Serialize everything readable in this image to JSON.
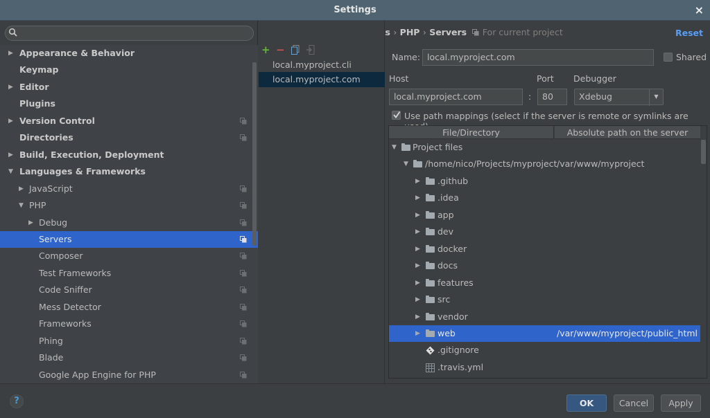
{
  "window": {
    "title": "Settings",
    "close_icon": "×"
  },
  "search": {
    "placeholder": "",
    "value": ""
  },
  "sidebar": {
    "items": [
      {
        "label": "Appearance & Behavior",
        "level": 0,
        "expander": "collapsed",
        "bold": true,
        "project_icon": false,
        "selected": false
      },
      {
        "label": "Keymap",
        "level": 0,
        "expander": "none",
        "bold": true,
        "project_icon": false,
        "selected": false
      },
      {
        "label": "Editor",
        "level": 0,
        "expander": "collapsed",
        "bold": true,
        "project_icon": false,
        "selected": false
      },
      {
        "label": "Plugins",
        "level": 0,
        "expander": "none",
        "bold": true,
        "project_icon": false,
        "selected": false
      },
      {
        "label": "Version Control",
        "level": 0,
        "expander": "collapsed",
        "bold": true,
        "project_icon": true,
        "selected": false
      },
      {
        "label": "Directories",
        "level": 0,
        "expander": "none",
        "bold": true,
        "project_icon": true,
        "selected": false
      },
      {
        "label": "Build, Execution, Deployment",
        "level": 0,
        "expander": "collapsed",
        "bold": true,
        "project_icon": false,
        "selected": false
      },
      {
        "label": "Languages & Frameworks",
        "level": 0,
        "expander": "expanded",
        "bold": true,
        "project_icon": false,
        "selected": false
      },
      {
        "label": "JavaScript",
        "level": 1,
        "expander": "collapsed",
        "bold": false,
        "project_icon": true,
        "selected": false
      },
      {
        "label": "PHP",
        "level": 1,
        "expander": "expanded",
        "bold": false,
        "project_icon": true,
        "selected": false
      },
      {
        "label": "Debug",
        "level": 2,
        "expander": "collapsed",
        "bold": false,
        "project_icon": true,
        "selected": false
      },
      {
        "label": "Servers",
        "level": 2,
        "expander": "none",
        "bold": false,
        "project_icon": true,
        "selected": true
      },
      {
        "label": "Composer",
        "level": 2,
        "expander": "none",
        "bold": false,
        "project_icon": true,
        "selected": false
      },
      {
        "label": "Test Frameworks",
        "level": 2,
        "expander": "none",
        "bold": false,
        "project_icon": true,
        "selected": false
      },
      {
        "label": "Code Sniffer",
        "level": 2,
        "expander": "none",
        "bold": false,
        "project_icon": true,
        "selected": false
      },
      {
        "label": "Mess Detector",
        "level": 2,
        "expander": "none",
        "bold": false,
        "project_icon": true,
        "selected": false
      },
      {
        "label": "Frameworks",
        "level": 2,
        "expander": "none",
        "bold": false,
        "project_icon": true,
        "selected": false
      },
      {
        "label": "Phing",
        "level": 2,
        "expander": "none",
        "bold": false,
        "project_icon": true,
        "selected": false
      },
      {
        "label": "Blade",
        "level": 2,
        "expander": "none",
        "bold": false,
        "project_icon": true,
        "selected": false
      },
      {
        "label": "Google App Engine for PHP",
        "level": 2,
        "expander": "none",
        "bold": false,
        "project_icon": true,
        "selected": false
      }
    ]
  },
  "breadcrumb": {
    "parts": [
      "Languages & Frameworks",
      "PHP",
      "Servers"
    ],
    "separator": "›",
    "scope": "For current project",
    "reset_label": "Reset"
  },
  "server_toolbar": {
    "add": "+",
    "remove": "−",
    "copy_icon": "copy-icon",
    "import_icon": "import-icon"
  },
  "servers": [
    {
      "name": "local.myproject.cli",
      "selected": false
    },
    {
      "name": "local.myproject.com",
      "selected": true
    }
  ],
  "form": {
    "name_label": "Name:",
    "name_value": "local.myproject.com",
    "shared_label": "Shared",
    "shared_checked": false,
    "host_label": "Host",
    "host_value": "local.myproject.com",
    "colon": ":",
    "port_label": "Port",
    "port_value": "80",
    "debugger_label": "Debugger",
    "debugger_value": "Xdebug",
    "path_mappings_label": "Use path mappings (select if the server is remote or symlinks are used)",
    "path_mappings_checked": true
  },
  "mappings": {
    "columns": [
      "File/Directory",
      "Absolute path on the server"
    ],
    "rows": [
      {
        "name": "Project files",
        "level": 0,
        "expander": "expanded",
        "icon": "folder",
        "path": "",
        "selected": false
      },
      {
        "name": "/home/nico/Projects/myproject",
        "level": 1,
        "expander": "expanded",
        "icon": "folder",
        "path": "/var/www/myproject",
        "selected": false
      },
      {
        "name": ".github",
        "level": 2,
        "expander": "collapsed",
        "icon": "folder",
        "path": "",
        "selected": false
      },
      {
        "name": ".idea",
        "level": 2,
        "expander": "collapsed",
        "icon": "folder",
        "path": "",
        "selected": false
      },
      {
        "name": "app",
        "level": 2,
        "expander": "collapsed",
        "icon": "folder",
        "path": "",
        "selected": false
      },
      {
        "name": "dev",
        "level": 2,
        "expander": "collapsed",
        "icon": "folder",
        "path": "",
        "selected": false
      },
      {
        "name": "docker",
        "level": 2,
        "expander": "collapsed",
        "icon": "folder",
        "path": "",
        "selected": false
      },
      {
        "name": "docs",
        "level": 2,
        "expander": "collapsed",
        "icon": "folder",
        "path": "",
        "selected": false
      },
      {
        "name": "features",
        "level": 2,
        "expander": "collapsed",
        "icon": "folder",
        "path": "",
        "selected": false
      },
      {
        "name": "src",
        "level": 2,
        "expander": "collapsed",
        "icon": "folder",
        "path": "",
        "selected": false
      },
      {
        "name": "vendor",
        "level": 2,
        "expander": "collapsed",
        "icon": "folder",
        "path": "",
        "selected": false
      },
      {
        "name": "web",
        "level": 2,
        "expander": "collapsed",
        "icon": "folder",
        "path": "/var/www/myproject/public_html",
        "selected": true
      },
      {
        "name": ".gitignore",
        "level": 2,
        "expander": "none",
        "icon": "git-file",
        "path": "",
        "selected": false
      },
      {
        "name": ".travis.yml",
        "level": 2,
        "expander": "none",
        "icon": "yaml-file",
        "path": "",
        "selected": false
      }
    ]
  },
  "footer": {
    "help": "?",
    "ok": "OK",
    "cancel": "Cancel",
    "apply": "Apply"
  },
  "colors": {
    "accent": "#2f65ca",
    "link": "#589df6",
    "add": "#5fb832",
    "remove": "#c75450",
    "ok_button": "#365880"
  }
}
